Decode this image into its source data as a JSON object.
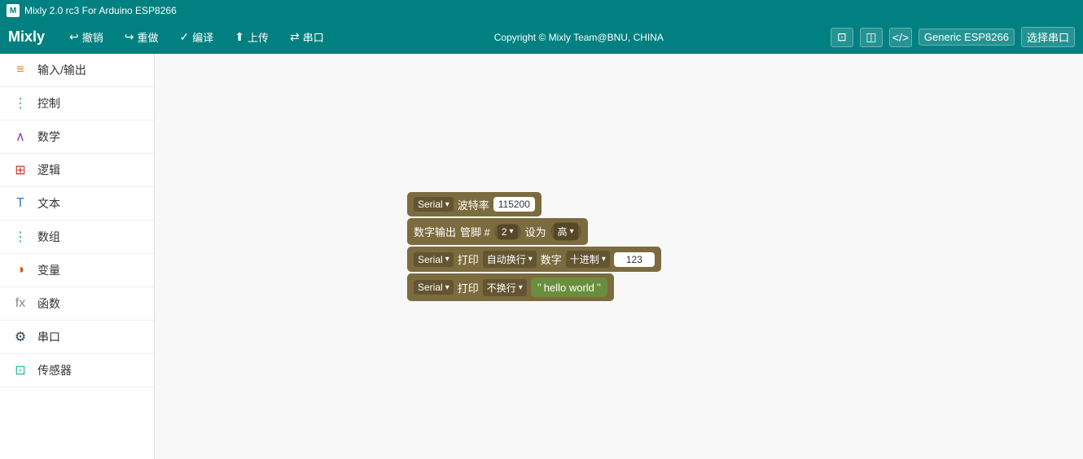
{
  "titlebar": {
    "logo": "M",
    "title": "Mixly 2.0 rc3 For Arduino ESP8266"
  },
  "toolbar": {
    "brand": "Mixly",
    "undo": "撤销",
    "redo": "重做",
    "compile": "编译",
    "upload": "上传",
    "serial": "串口",
    "copyright": "Copyright © Mixly Team@BNU, CHINA",
    "board": "Generic ESP8266",
    "select_port": "选择串口"
  },
  "sidebar": {
    "items": [
      {
        "id": "io",
        "icon": "≡",
        "label": "输入/输出",
        "cat": "cat-io"
      },
      {
        "id": "control",
        "icon": "⋮",
        "label": "控制",
        "cat": "cat-control"
      },
      {
        "id": "math",
        "icon": "∧",
        "label": "数学",
        "cat": "cat-math"
      },
      {
        "id": "logic",
        "icon": "☐",
        "label": "逻辑",
        "cat": "cat-logic"
      },
      {
        "id": "text",
        "icon": "T",
        "label": "文本",
        "cat": "cat-text"
      },
      {
        "id": "array",
        "icon": "⋮=",
        "label": "数组",
        "cat": "cat-array"
      },
      {
        "id": "var",
        "icon": "○",
        "label": "变量",
        "cat": "cat-var"
      },
      {
        "id": "func",
        "icon": "fx",
        "label": "函数",
        "cat": "cat-func"
      },
      {
        "id": "serial",
        "icon": "⚙",
        "label": "串口",
        "cat": "cat-serial"
      },
      {
        "id": "sensor",
        "icon": "⊡",
        "label": "传感器",
        "cat": "cat-sensor"
      }
    ]
  },
  "blocks": {
    "block1": {
      "serial_label": "Serial",
      "baud_label": "波特率",
      "baud_value": "115200"
    },
    "block2": {
      "label": "数字输出",
      "pin_label": "管脚 #",
      "pin_value": "2",
      "set_label": "设为",
      "level_value": "高"
    },
    "block3": {
      "serial_label": "Serial",
      "print_label": "打印",
      "mode_label": "自动换行",
      "type_label": "数字",
      "format_label": "十进制",
      "value": "123"
    },
    "block4": {
      "serial_label": "Serial",
      "print_label": "打印",
      "mode_label": "不换行",
      "quote_open": "\"",
      "text_value": "hello world",
      "quote_close": "\""
    }
  }
}
